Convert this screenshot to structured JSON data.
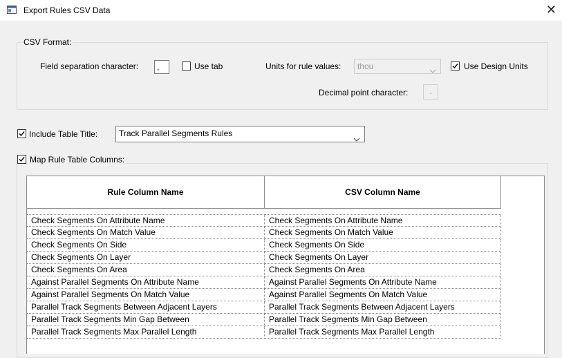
{
  "window": {
    "title": "Export Rules CSV Data",
    "close_symbol": "✕"
  },
  "csv_format": {
    "group_label": "CSV Format:",
    "field_sep_label": "Field separation character:",
    "field_sep_value": ",",
    "use_tab_label": "Use tab",
    "use_tab_checked": false,
    "units_label": "Units for rule values:",
    "units_value": "thou",
    "use_design_units_label": "Use Design Units",
    "use_design_units_checked": true,
    "decimal_label": "Decimal point character:",
    "decimal_value": "."
  },
  "table_title": {
    "checkbox_label": "Include Table Title:",
    "checked": true,
    "value": "Track Parallel Segments Rules"
  },
  "map_columns": {
    "checkbox_label": "Map Rule Table Columns:",
    "checked": true,
    "headers": [
      "Rule Column Name",
      "CSV Column Name"
    ],
    "rows": [
      [
        "Check Segments On Attribute Name",
        "Check Segments On Attribute Name"
      ],
      [
        "Check Segments On Match Value",
        "Check Segments On Match Value"
      ],
      [
        "Check Segments On Side",
        "Check Segments On Side"
      ],
      [
        "Check Segments On Layer",
        "Check Segments On Layer"
      ],
      [
        "Check Segments On Area",
        "Check Segments On Area"
      ],
      [
        "Against Parallel Segments On Attribute Name",
        "Against Parallel Segments On Attribute Name"
      ],
      [
        "Against Parallel Segments On Match Value",
        "Against Parallel Segments On Match Value"
      ],
      [
        "Parallel Track Segments Between Adjacent Layers",
        "Parallel Track Segments Between Adjacent Layers"
      ],
      [
        "Parallel Track Segments Min Gap Between",
        "Parallel Track Segments Min Gap Between"
      ],
      [
        "Parallel Track Segments Max Parallel Length",
        "Parallel Track Segments Max Parallel Length"
      ]
    ]
  }
}
